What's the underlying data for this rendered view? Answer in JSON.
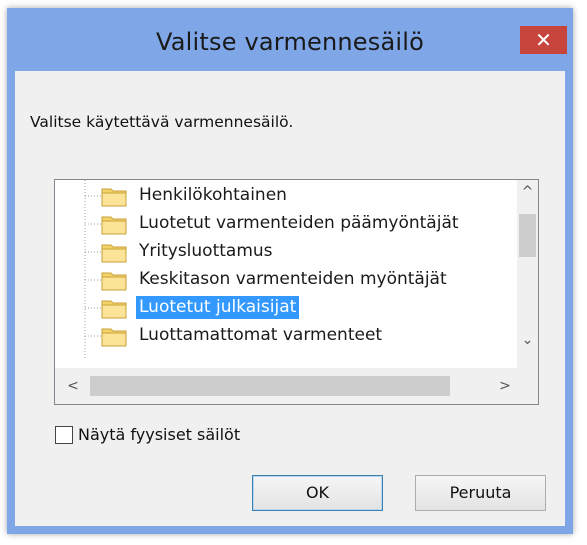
{
  "window": {
    "title": "Valitse varmennesäilö",
    "close_glyph": "✕"
  },
  "dialog": {
    "instruction": "Valitse käytettävä varmennesäilö.",
    "tree": {
      "items": [
        {
          "label": "Henkilökohtainen",
          "selected": false
        },
        {
          "label": "Luotetut varmenteiden päämyöntäjät",
          "selected": false
        },
        {
          "label": "Yritysluottamus",
          "selected": false
        },
        {
          "label": "Keskitason varmenteiden myöntäjät",
          "selected": false
        },
        {
          "label": "Luotetut julkaisijat",
          "selected": true
        },
        {
          "label": "Luottamattomat varmenteet",
          "selected": false
        }
      ],
      "scroll_up": "^",
      "scroll_down": "⌄",
      "scroll_left": "<",
      "scroll_right": ">"
    },
    "show_physical": {
      "label": "Näytä fyysiset säilöt",
      "checked": false
    },
    "buttons": {
      "ok": "OK",
      "cancel": "Peruuta"
    }
  },
  "colors": {
    "frame": "#7fa6e6",
    "close": "#c7453c",
    "selection": "#3399ff"
  },
  "icons": {
    "folder": "folder-icon",
    "close": "close-icon"
  }
}
